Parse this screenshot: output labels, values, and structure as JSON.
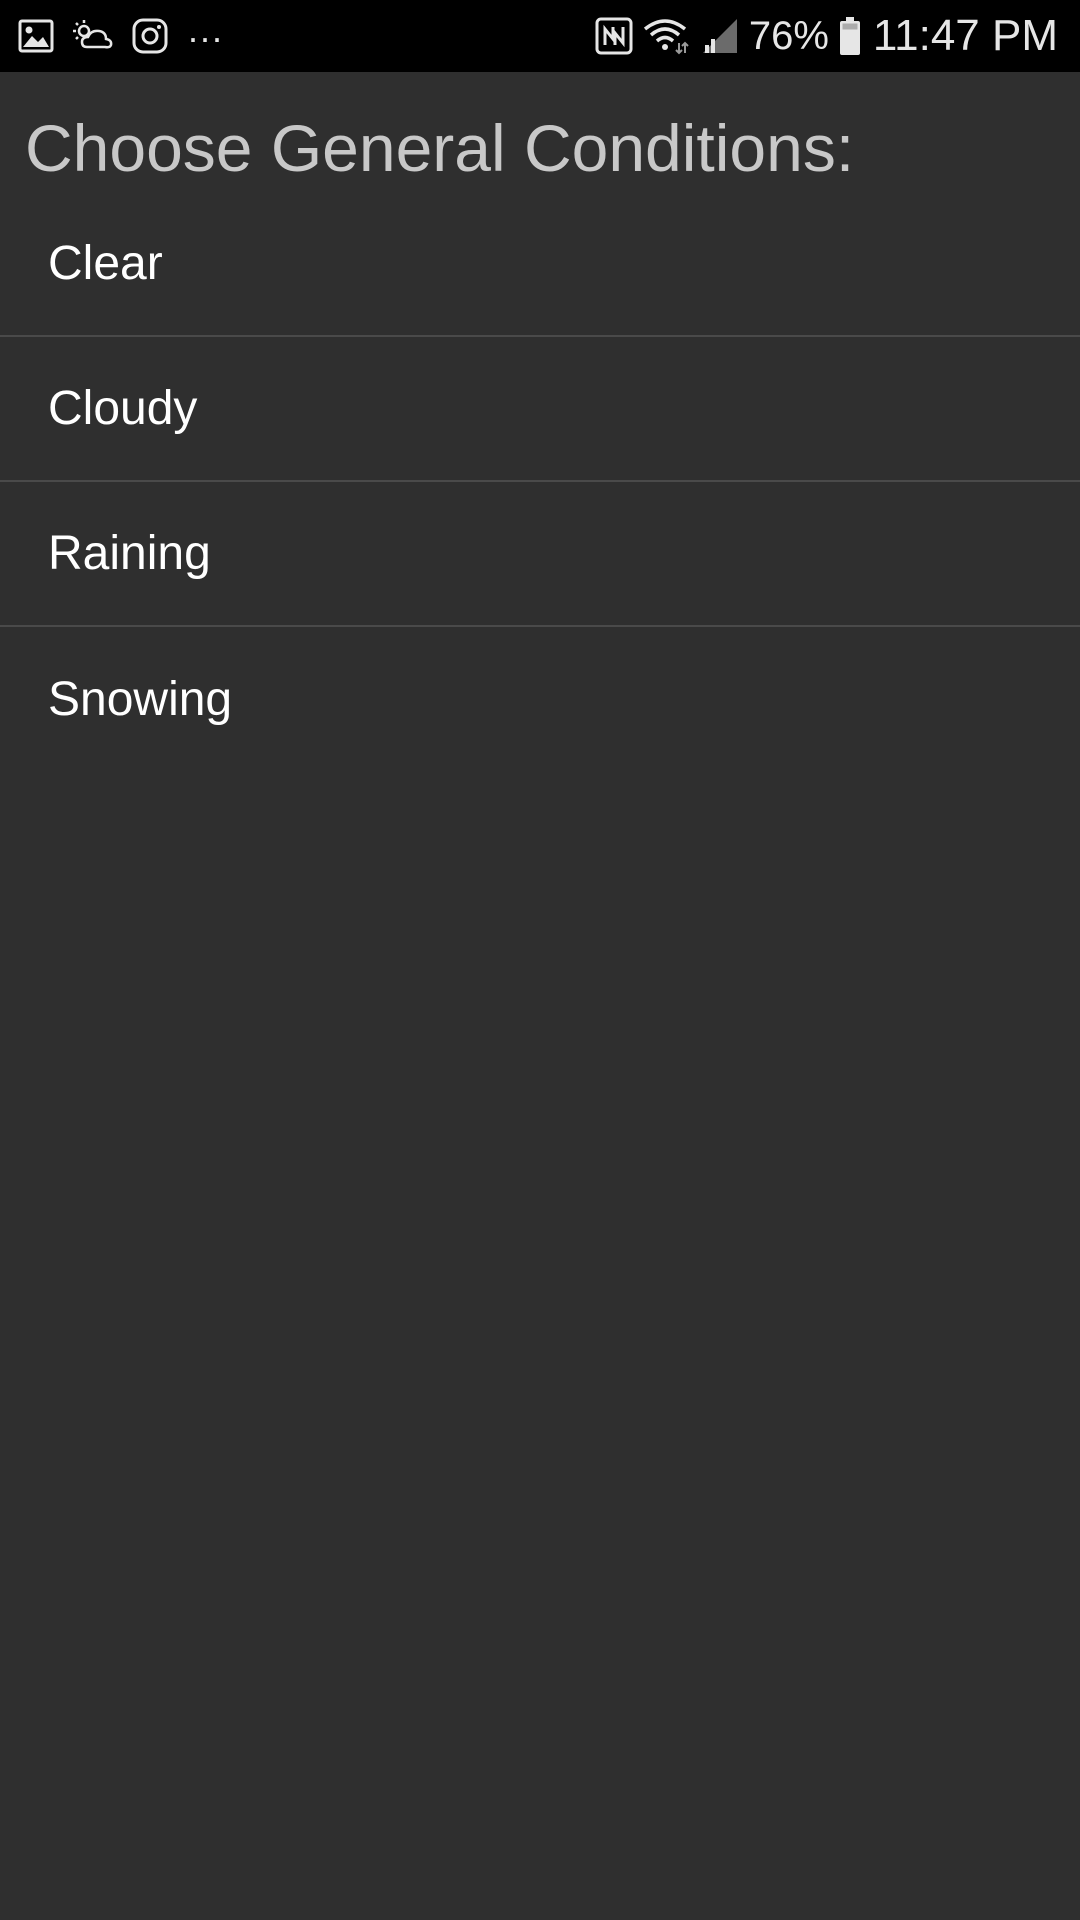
{
  "status_bar": {
    "left_icons": [
      "gallery-icon",
      "weather-icon",
      "instagram-icon"
    ],
    "overflow_indicator": "...",
    "right_icons": [
      "nfc-icon",
      "wifi-icon",
      "signal-icon",
      "battery-icon"
    ],
    "battery_percent": "76%",
    "time": "11:47 PM"
  },
  "page": {
    "title": "Choose General Conditions:"
  },
  "conditions": {
    "items": [
      {
        "label": "Clear"
      },
      {
        "label": "Cloudy"
      },
      {
        "label": "Raining"
      },
      {
        "label": "Snowing"
      }
    ]
  },
  "colors": {
    "background": "#2f2f2f",
    "status_bar": "#000000",
    "title": "#c8c8c8",
    "item_text": "#ffffff",
    "divider": "#4a4a4a"
  }
}
